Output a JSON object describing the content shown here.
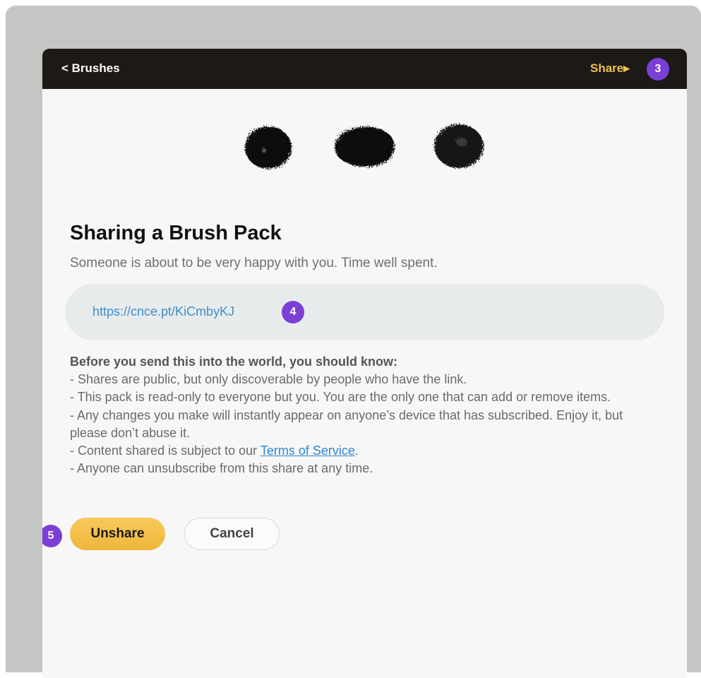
{
  "navbar": {
    "back_label": "< Brushes",
    "share_label": "Share▸",
    "share_badge": "3"
  },
  "brush_previews": [
    "brush-stamp-1",
    "brush-stamp-2",
    "brush-stamp-3"
  ],
  "main": {
    "title": "Sharing a Brush Pack",
    "subtitle": "Someone is about to be very happy with you. Time well spent.",
    "share_link": "https://cnce.pt/KiCmbyKJ",
    "link_badge": "4"
  },
  "notice": {
    "heading": "Before you send this into the world, you should know:",
    "line1": "- Shares are public, but only discoverable by people who have the link.",
    "line2": "- This pack is read-only to everyone but you. You are the only one that can add or remove items.",
    "line3": "- Any changes you make will instantly appear on anyone’s device that has subscribed. Enjoy it, but please don’t abuse it.",
    "line4_prefix": "- Content shared is subject to our ",
    "terms_link": "Terms of Service",
    "line4_suffix": ".",
    "line5": "- Anyone can unsubscribe from this share at any time."
  },
  "actions": {
    "unshare_label": "Unshare",
    "cancel_label": "Cancel",
    "unshare_badge": "5"
  },
  "colors": {
    "navbar_bg": "#1d1916",
    "share_accent": "#f1bf4f",
    "badge": "#7b3fd6",
    "link": "#3f8ec7",
    "unshare_button": "#f3c04b"
  }
}
